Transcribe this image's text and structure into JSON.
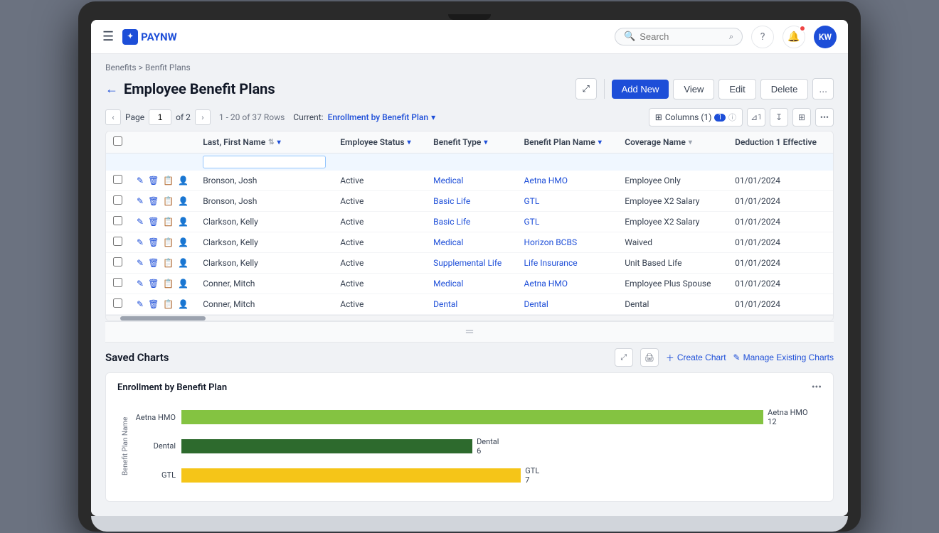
{
  "nav": {
    "logo_text": "PAYNW",
    "search_placeholder": "Search",
    "user_initials": "KW"
  },
  "breadcrumb": {
    "parent": "Benefits",
    "separator": ">",
    "current": "Benfit Plans"
  },
  "page": {
    "title": "Employee Benefit Plans",
    "toolbar": {
      "add_new": "Add New",
      "view": "View",
      "edit": "Edit",
      "delete": "Delete",
      "more": "..."
    }
  },
  "pagination": {
    "label": "Page",
    "current_page": "1",
    "of_label": "of 2",
    "range_label": "1 - 20 of 37 Rows",
    "current_label": "Current:",
    "current_filter": "Enrollment by Benefit Plan",
    "columns_label": "Columns (1)",
    "filter_icon": "▼"
  },
  "table": {
    "columns": [
      {
        "key": "checkbox",
        "label": ""
      },
      {
        "key": "actions",
        "label": ""
      },
      {
        "key": "last_first_name",
        "label": "Last, First Name"
      },
      {
        "key": "employee_status",
        "label": "Employee Status"
      },
      {
        "key": "benefit_type",
        "label": "Benefit Type"
      },
      {
        "key": "benefit_plan_name",
        "label": "Benefit Plan Name"
      },
      {
        "key": "coverage_name",
        "label": "Coverage Name"
      },
      {
        "key": "deduction_1_effective",
        "label": "Deduction 1 Effective"
      }
    ],
    "rows": [
      {
        "name": "Bronson, Josh",
        "status": "Active",
        "benefit_type": "Medical",
        "benefit_plan_name": "Aetna HMO",
        "coverage_name": "Employee Only",
        "deduction": "01/01/2024"
      },
      {
        "name": "Bronson, Josh",
        "status": "Active",
        "benefit_type": "Basic Life",
        "benefit_plan_name": "GTL",
        "coverage_name": "Employee X2 Salary",
        "deduction": "01/01/2024"
      },
      {
        "name": "Clarkson, Kelly",
        "status": "Active",
        "benefit_type": "Basic Life",
        "benefit_plan_name": "GTL",
        "coverage_name": "Employee X2 Salary",
        "deduction": "01/01/2024"
      },
      {
        "name": "Clarkson, Kelly",
        "status": "Active",
        "benefit_type": "Medical",
        "benefit_plan_name": "Horizon BCBS",
        "coverage_name": "Waived",
        "deduction": "01/01/2024"
      },
      {
        "name": "Clarkson, Kelly",
        "status": "Active",
        "benefit_type": "Supplemental Life",
        "benefit_plan_name": "Life Insurance",
        "coverage_name": "Unit Based Life",
        "deduction": "01/01/2024"
      },
      {
        "name": "Conner, Mitch",
        "status": "Active",
        "benefit_type": "Medical",
        "benefit_plan_name": "Aetna HMO",
        "coverage_name": "Employee Plus Spouse",
        "deduction": "01/01/2024"
      },
      {
        "name": "Conner, Mitch",
        "status": "Active",
        "benefit_type": "Dental",
        "benefit_plan_name": "Dental",
        "coverage_name": "Dental",
        "deduction": "01/01/2024"
      }
    ]
  },
  "saved_charts": {
    "title": "Saved Charts",
    "create_chart": "Create Chart",
    "manage_charts": "Manage Existing Charts",
    "chart": {
      "title": "Enrollment by Benefit Plan",
      "y_axis_label": "Benefit Plan Name",
      "bars": [
        {
          "label": "Aetna HMO",
          "value": 12,
          "max": 12,
          "color": "#84c341",
          "end_label": "Aetna HMO\n12"
        },
        {
          "label": "Dental",
          "value": 6,
          "max": 12,
          "color": "#2d6a2d",
          "end_label": "Dental\n6"
        },
        {
          "label": "GTL",
          "value": 7,
          "max": 12,
          "color": "#f5c518",
          "end_label": "GTL\n7"
        }
      ]
    }
  }
}
